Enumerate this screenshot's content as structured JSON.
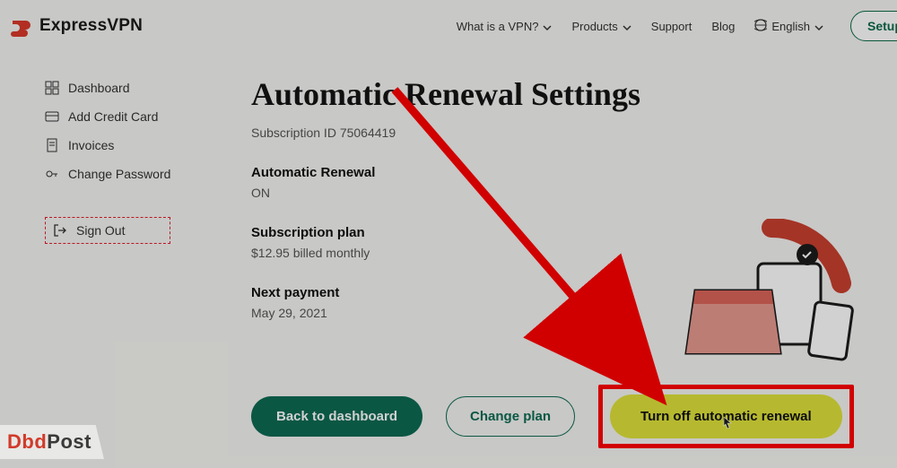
{
  "brand": {
    "name": "ExpressVPN"
  },
  "nav": {
    "whatvpn": "What is a VPN?",
    "products": "Products",
    "support": "Support",
    "blog": "Blog",
    "lang": "English",
    "setup": "Setup"
  },
  "sidebar": {
    "items": [
      {
        "label": "Dashboard"
      },
      {
        "label": "Add Credit Card"
      },
      {
        "label": "Invoices"
      },
      {
        "label": "Change Password"
      }
    ],
    "signout": "Sign Out"
  },
  "main": {
    "title": "Automatic Renewal Settings",
    "subid_label": "Subscription ID",
    "subid_value": "75064419",
    "auto_label": "Automatic Renewal",
    "auto_value": "ON",
    "plan_label": "Subscription plan",
    "plan_value": "$12.95 billed monthly",
    "next_label": "Next payment",
    "next_value": "May 29, 2021"
  },
  "buttons": {
    "back": "Back to dashboard",
    "change": "Change plan",
    "turnoff": "Turn off automatic renewal"
  },
  "watermark": {
    "a": "Dbd",
    "b": "Post"
  }
}
